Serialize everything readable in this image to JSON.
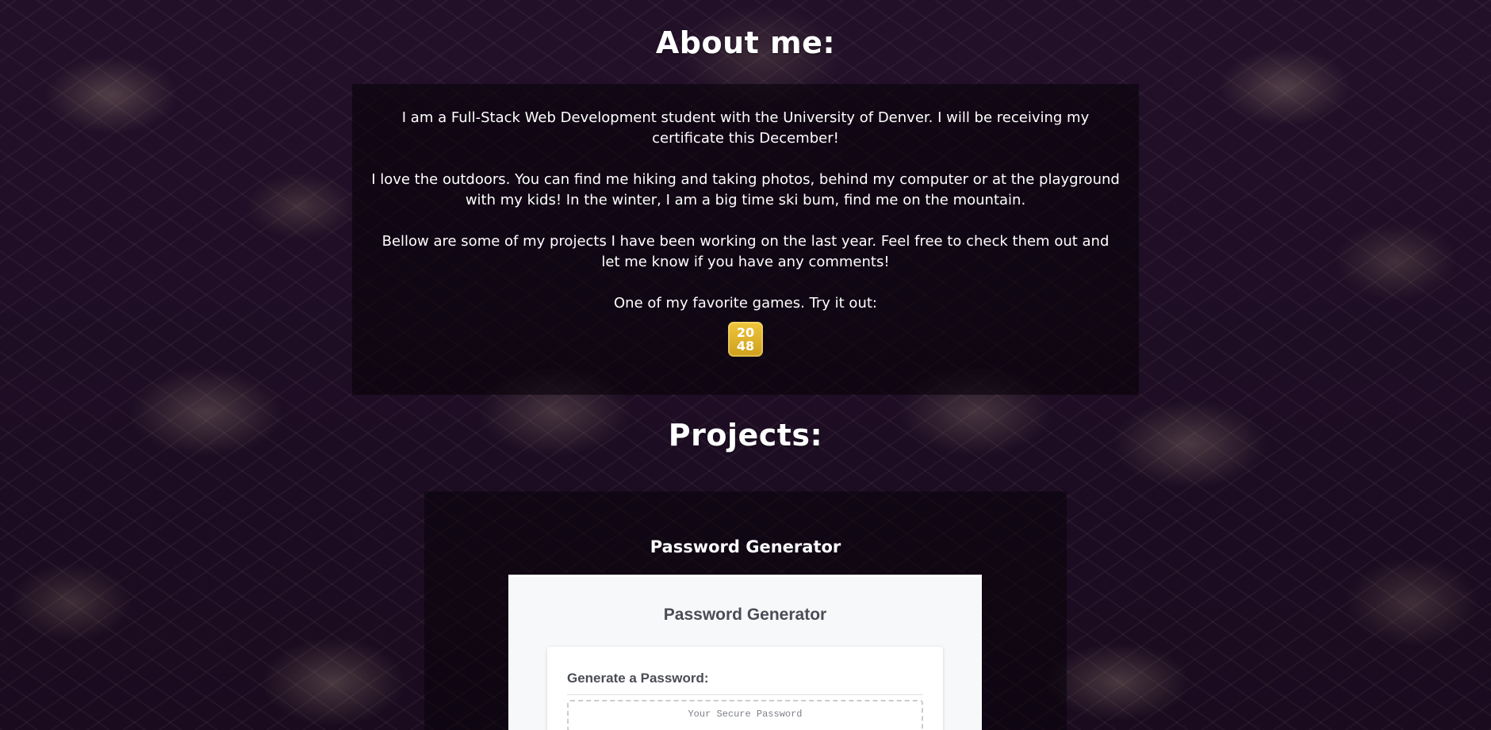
{
  "about": {
    "title": "About me:",
    "paragraphs": [
      "I am a Full-Stack Web Development student with the University of Denver. I will be receiving my certificate this December!",
      "I love the outdoors. You can find me hiking and taking photos, behind my computer or at the playground with my kids! In the winter, I am a big time ski bum, find me on the mountain.",
      "Bellow are some of my projects I have been working on the last year. Feel free to check them out and let me know if you have any comments!"
    ],
    "games_line": "One of my favorite games. Try it out:",
    "game_icon": {
      "top": "20",
      "bottom": "48",
      "color": "#e0b12e"
    }
  },
  "projects": {
    "title": "Projects:",
    "items": [
      {
        "title": "Password Generator",
        "screenshot": {
          "app_title": "Password Generator",
          "card_heading": "Generate a Password:",
          "output_placeholder": "Your Secure Password"
        }
      }
    ]
  }
}
